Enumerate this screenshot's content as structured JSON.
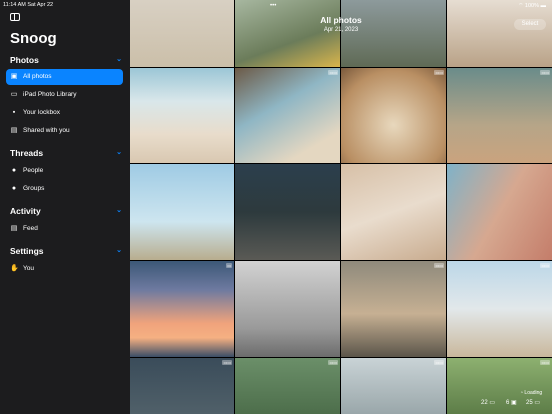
{
  "status": {
    "time": "11:14 AM",
    "date": "Sat Apr 22",
    "battery": "100%"
  },
  "app": {
    "title": "Snoog"
  },
  "sections": {
    "photos": {
      "label": "Photos",
      "items": [
        "All photos",
        "iPad Photo Library",
        "Your lockbox",
        "Shared with you"
      ]
    },
    "threads": {
      "label": "Threads",
      "items": [
        "People",
        "Groups"
      ]
    },
    "activity": {
      "label": "Activity",
      "items": [
        "Feed"
      ]
    },
    "settings": {
      "label": "Settings",
      "items": [
        "You"
      ]
    }
  },
  "main": {
    "title": "All photos",
    "date": "Apr 21, 2023",
    "select_label": "Select",
    "loading_label": "Loading"
  },
  "counts": {
    "a": "22",
    "b": "6",
    "c": "25"
  },
  "colors": {
    "accent": "#0a84ff",
    "sidebar": "#1c1c1e"
  }
}
